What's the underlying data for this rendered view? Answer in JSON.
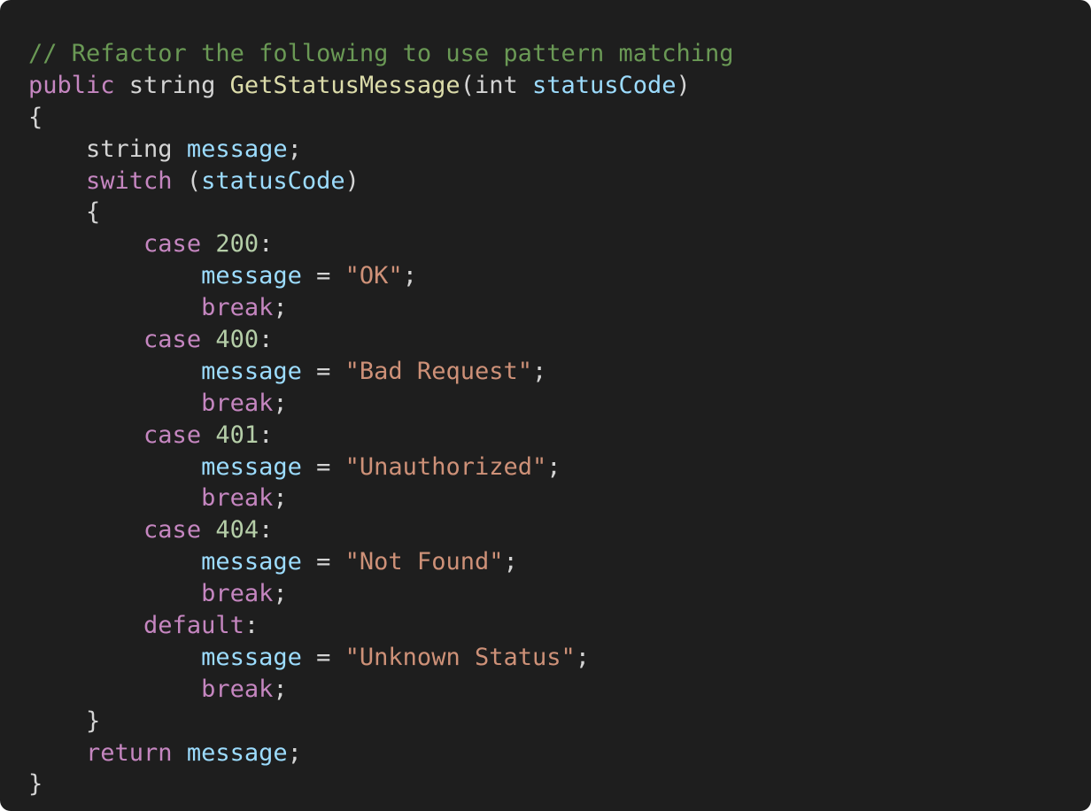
{
  "colors": {
    "background": "#1e1e1e",
    "plain": "#d4d4d4",
    "comment": "#6a9955",
    "keyword": "#c586c0",
    "type": "#d4d4d4",
    "function": "#dcdcaa",
    "variable": "#9cdcfe",
    "number": "#b5cea8",
    "string": "#ce9178"
  },
  "code_lines": [
    [
      {
        "t": "// Refactor the following to use pattern matching",
        "k": "comment"
      }
    ],
    [
      {
        "t": "public",
        "k": "keyword"
      },
      {
        "t": " string ",
        "k": "plain"
      },
      {
        "t": "GetStatusMessage",
        "k": "function"
      },
      {
        "t": "(int ",
        "k": "plain"
      },
      {
        "t": "statusCode",
        "k": "variable"
      },
      {
        "t": ")",
        "k": "plain"
      }
    ],
    [
      {
        "t": "{",
        "k": "plain"
      }
    ],
    [
      {
        "t": "    string ",
        "k": "plain"
      },
      {
        "t": "message",
        "k": "variable"
      },
      {
        "t": ";",
        "k": "plain"
      }
    ],
    [
      {
        "t": "    ",
        "k": "plain"
      },
      {
        "t": "switch",
        "k": "keyword"
      },
      {
        "t": " (",
        "k": "plain"
      },
      {
        "t": "statusCode",
        "k": "variable"
      },
      {
        "t": ")",
        "k": "plain"
      }
    ],
    [
      {
        "t": "    {",
        "k": "plain"
      }
    ],
    [
      {
        "t": "        ",
        "k": "plain"
      },
      {
        "t": "case",
        "k": "keyword"
      },
      {
        "t": " ",
        "k": "plain"
      },
      {
        "t": "200",
        "k": "number"
      },
      {
        "t": ":",
        "k": "plain"
      }
    ],
    [
      {
        "t": "            ",
        "k": "plain"
      },
      {
        "t": "message",
        "k": "variable"
      },
      {
        "t": " = ",
        "k": "plain"
      },
      {
        "t": "\"OK\"",
        "k": "string"
      },
      {
        "t": ";",
        "k": "plain"
      }
    ],
    [
      {
        "t": "            ",
        "k": "plain"
      },
      {
        "t": "break",
        "k": "keyword"
      },
      {
        "t": ";",
        "k": "plain"
      }
    ],
    [
      {
        "t": "        ",
        "k": "plain"
      },
      {
        "t": "case",
        "k": "keyword"
      },
      {
        "t": " ",
        "k": "plain"
      },
      {
        "t": "400",
        "k": "number"
      },
      {
        "t": ":",
        "k": "plain"
      }
    ],
    [
      {
        "t": "            ",
        "k": "plain"
      },
      {
        "t": "message",
        "k": "variable"
      },
      {
        "t": " = ",
        "k": "plain"
      },
      {
        "t": "\"Bad Request\"",
        "k": "string"
      },
      {
        "t": ";",
        "k": "plain"
      }
    ],
    [
      {
        "t": "            ",
        "k": "plain"
      },
      {
        "t": "break",
        "k": "keyword"
      },
      {
        "t": ";",
        "k": "plain"
      }
    ],
    [
      {
        "t": "        ",
        "k": "plain"
      },
      {
        "t": "case",
        "k": "keyword"
      },
      {
        "t": " ",
        "k": "plain"
      },
      {
        "t": "401",
        "k": "number"
      },
      {
        "t": ":",
        "k": "plain"
      }
    ],
    [
      {
        "t": "            ",
        "k": "plain"
      },
      {
        "t": "message",
        "k": "variable"
      },
      {
        "t": " = ",
        "k": "plain"
      },
      {
        "t": "\"Unauthorized\"",
        "k": "string"
      },
      {
        "t": ";",
        "k": "plain"
      }
    ],
    [
      {
        "t": "            ",
        "k": "plain"
      },
      {
        "t": "break",
        "k": "keyword"
      },
      {
        "t": ";",
        "k": "plain"
      }
    ],
    [
      {
        "t": "        ",
        "k": "plain"
      },
      {
        "t": "case",
        "k": "keyword"
      },
      {
        "t": " ",
        "k": "plain"
      },
      {
        "t": "404",
        "k": "number"
      },
      {
        "t": ":",
        "k": "plain"
      }
    ],
    [
      {
        "t": "            ",
        "k": "plain"
      },
      {
        "t": "message",
        "k": "variable"
      },
      {
        "t": " = ",
        "k": "plain"
      },
      {
        "t": "\"Not Found\"",
        "k": "string"
      },
      {
        "t": ";",
        "k": "plain"
      }
    ],
    [
      {
        "t": "            ",
        "k": "plain"
      },
      {
        "t": "break",
        "k": "keyword"
      },
      {
        "t": ";",
        "k": "plain"
      }
    ],
    [
      {
        "t": "        ",
        "k": "plain"
      },
      {
        "t": "default",
        "k": "keyword"
      },
      {
        "t": ":",
        "k": "plain"
      }
    ],
    [
      {
        "t": "            ",
        "k": "plain"
      },
      {
        "t": "message",
        "k": "variable"
      },
      {
        "t": " = ",
        "k": "plain"
      },
      {
        "t": "\"Unknown Status\"",
        "k": "string"
      },
      {
        "t": ";",
        "k": "plain"
      }
    ],
    [
      {
        "t": "            ",
        "k": "plain"
      },
      {
        "t": "break",
        "k": "keyword"
      },
      {
        "t": ";",
        "k": "plain"
      }
    ],
    [
      {
        "t": "    }",
        "k": "plain"
      }
    ],
    [
      {
        "t": "    ",
        "k": "plain"
      },
      {
        "t": "return",
        "k": "keyword"
      },
      {
        "t": " ",
        "k": "plain"
      },
      {
        "t": "message",
        "k": "variable"
      },
      {
        "t": ";",
        "k": "plain"
      }
    ],
    [
      {
        "t": "}",
        "k": "plain"
      }
    ]
  ]
}
